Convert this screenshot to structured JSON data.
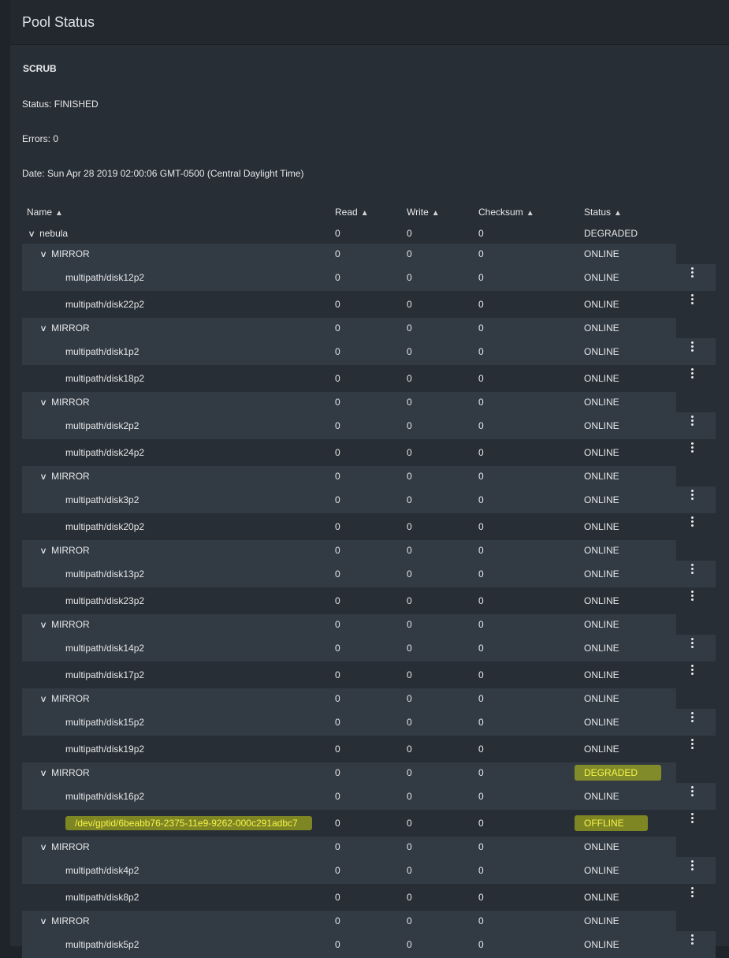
{
  "panel_title": "Pool Status",
  "scrub": {
    "heading": "SCRUB",
    "status": "Status: FINISHED",
    "errors": "Errors: 0",
    "date": "Date: Sun Apr 28 2019 02:00:06 GMT-0500 (Central Daylight Time)"
  },
  "columns": [
    "Name",
    "Read",
    "Write",
    "Checksum",
    "Status"
  ],
  "rows": [
    {
      "level": "pool",
      "name": "nebula",
      "read": "0",
      "write": "0",
      "checksum": "0",
      "status": "DEGRADED"
    },
    {
      "level": "mirror",
      "name": "MIRROR",
      "read": "0",
      "write": "0",
      "checksum": "0",
      "status": "ONLINE"
    },
    {
      "level": "disk",
      "name": "multipath/disk12p2",
      "read": "0",
      "write": "0",
      "checksum": "0",
      "status": "ONLINE"
    },
    {
      "level": "disk",
      "name": "multipath/disk22p2",
      "read": "0",
      "write": "0",
      "checksum": "0",
      "status": "ONLINE"
    },
    {
      "level": "mirror",
      "name": "MIRROR",
      "read": "0",
      "write": "0",
      "checksum": "0",
      "status": "ONLINE"
    },
    {
      "level": "disk",
      "name": "multipath/disk1p2",
      "read": "0",
      "write": "0",
      "checksum": "0",
      "status": "ONLINE"
    },
    {
      "level": "disk",
      "name": "multipath/disk18p2",
      "read": "0",
      "write": "0",
      "checksum": "0",
      "status": "ONLINE"
    },
    {
      "level": "mirror",
      "name": "MIRROR",
      "read": "0",
      "write": "0",
      "checksum": "0",
      "status": "ONLINE"
    },
    {
      "level": "disk",
      "name": "multipath/disk2p2",
      "read": "0",
      "write": "0",
      "checksum": "0",
      "status": "ONLINE"
    },
    {
      "level": "disk",
      "name": "multipath/disk24p2",
      "read": "0",
      "write": "0",
      "checksum": "0",
      "status": "ONLINE"
    },
    {
      "level": "mirror",
      "name": "MIRROR",
      "read": "0",
      "write": "0",
      "checksum": "0",
      "status": "ONLINE"
    },
    {
      "level": "disk",
      "name": "multipath/disk3p2",
      "read": "0",
      "write": "0",
      "checksum": "0",
      "status": "ONLINE"
    },
    {
      "level": "disk",
      "name": "multipath/disk20p2",
      "read": "0",
      "write": "0",
      "checksum": "0",
      "status": "ONLINE"
    },
    {
      "level": "mirror",
      "name": "MIRROR",
      "read": "0",
      "write": "0",
      "checksum": "0",
      "status": "ONLINE"
    },
    {
      "level": "disk",
      "name": "multipath/disk13p2",
      "read": "0",
      "write": "0",
      "checksum": "0",
      "status": "ONLINE"
    },
    {
      "level": "disk",
      "name": "multipath/disk23p2",
      "read": "0",
      "write": "0",
      "checksum": "0",
      "status": "ONLINE"
    },
    {
      "level": "mirror",
      "name": "MIRROR",
      "read": "0",
      "write": "0",
      "checksum": "0",
      "status": "ONLINE"
    },
    {
      "level": "disk",
      "name": "multipath/disk14p2",
      "read": "0",
      "write": "0",
      "checksum": "0",
      "status": "ONLINE"
    },
    {
      "level": "disk",
      "name": "multipath/disk17p2",
      "read": "0",
      "write": "0",
      "checksum": "0",
      "status": "ONLINE"
    },
    {
      "level": "mirror",
      "name": "MIRROR",
      "read": "0",
      "write": "0",
      "checksum": "0",
      "status": "ONLINE"
    },
    {
      "level": "disk",
      "name": "multipath/disk15p2",
      "read": "0",
      "write": "0",
      "checksum": "0",
      "status": "ONLINE"
    },
    {
      "level": "disk",
      "name": "multipath/disk19p2",
      "read": "0",
      "write": "0",
      "checksum": "0",
      "status": "ONLINE"
    },
    {
      "level": "mirror",
      "name": "MIRROR",
      "read": "0",
      "write": "0",
      "checksum": "0",
      "status": "DEGRADED",
      "highlight": true
    },
    {
      "level": "disk",
      "name": "multipath/disk16p2",
      "read": "0",
      "write": "0",
      "checksum": "0",
      "status": "ONLINE"
    },
    {
      "level": "disk",
      "name": "/dev/gptid/6beabb76-2375-11e9-9262-000c291adbc7",
      "read": "0",
      "write": "0",
      "checksum": "0",
      "status": "OFFLINE",
      "highlight": true
    },
    {
      "level": "mirror",
      "name": "MIRROR",
      "read": "0",
      "write": "0",
      "checksum": "0",
      "status": "ONLINE"
    },
    {
      "level": "disk",
      "name": "multipath/disk4p2",
      "read": "0",
      "write": "0",
      "checksum": "0",
      "status": "ONLINE"
    },
    {
      "level": "disk",
      "name": "multipath/disk8p2",
      "read": "0",
      "write": "0",
      "checksum": "0",
      "status": "ONLINE"
    },
    {
      "level": "mirror",
      "name": "MIRROR",
      "read": "0",
      "write": "0",
      "checksum": "0",
      "status": "ONLINE"
    },
    {
      "level": "disk",
      "name": "multipath/disk5p2",
      "read": "0",
      "write": "0",
      "checksum": "0",
      "status": "ONLINE"
    }
  ],
  "icons": {
    "sort": "sort-icon",
    "expand": "chevron-down-icon",
    "menu": "more-vert-icon"
  },
  "colors": {
    "highlight": "#c4ce14",
    "background": "#282e35",
    "stripe": "#323a43"
  }
}
